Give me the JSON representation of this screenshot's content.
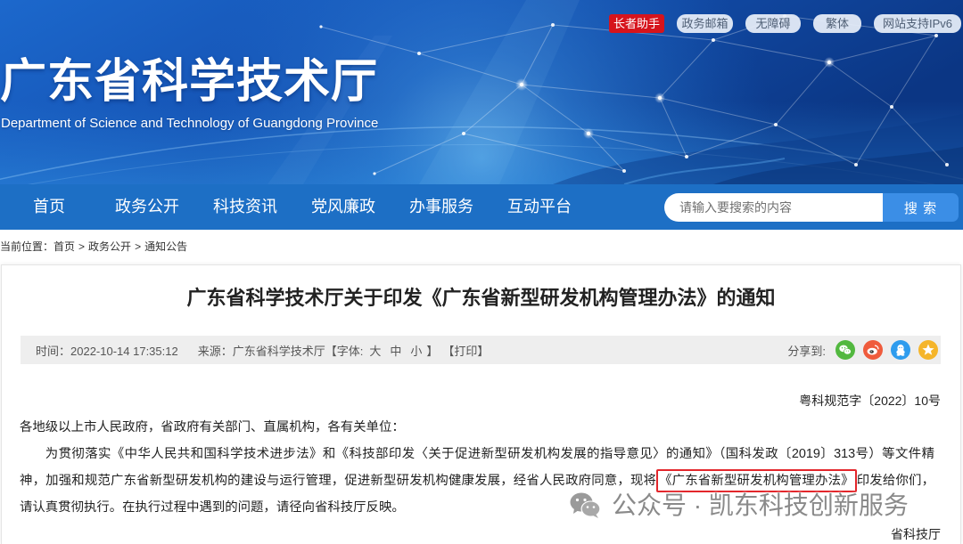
{
  "header": {
    "title": "广东省科学技术厅",
    "subtitle": "Department of Science and Technology of Guangdong Province",
    "top_links": [
      "长者助手",
      "政务邮箱",
      "无障碍",
      "繁体",
      "网站支持IPv6"
    ]
  },
  "nav": {
    "items": [
      "首页",
      "政务公开",
      "科技资讯",
      "党风廉政",
      "办事服务",
      "互动平台"
    ],
    "search": {
      "placeholder": "请输入要搜索的内容",
      "value": "",
      "button_label": "搜 索"
    }
  },
  "breadcrumb": {
    "prefix": "当前位置：",
    "items": [
      "首页",
      "政务公开",
      "通知公告"
    ],
    "separator": ">"
  },
  "article": {
    "title": "广东省科学技术厅关于印发《广东省新型研发机构管理办法》的通知",
    "meta": {
      "time": "时间：2022-10-14 17:35:12",
      "source": "来源：广东省科学技术厅",
      "font_label_open": "【字体:",
      "font_sizes": [
        "大",
        "中",
        "小"
      ],
      "font_label_close": "】",
      "print": "【打印】",
      "share_label": "分享到:",
      "share_icons": [
        "wechat-icon",
        "weibo-icon",
        "qq-icon",
        "qzone-star-icon"
      ]
    },
    "doc_number": "粤科规范字〔2022〕10号",
    "salutation": "各地级以上市人民政府，省政府有关部门、直属机构，各有关单位：",
    "body": {
      "before_highlight": "为贯彻落实《中华人民共和国科学技术进步法》和《科技部印发〈关于促进新型研发机构发展的指导意见〉的通知》（国科发政〔2019〕313号）等文件精神，加强和规范广东省新型研发机构的建设与运行管理，促进新型研发机构健康发展，经省人民政府同意，现将",
      "highlight": "《广东省新型研发机构管理办法》",
      "after_highlight": "印发给你们，请认真贯彻执行。在执行过程中遇到的问题，请径向省科技厅反映。"
    },
    "signature": "省科技厅"
  },
  "watermark": {
    "icon": "wechat-logo-icon",
    "text": "公众号 · 凯东科技创新服务"
  },
  "colors": {
    "nav_bg": "#1d6fc5",
    "search_button": "#3b8ee6",
    "elder_button": "#d6141c",
    "highlight_border": "#e3262b",
    "meta_bar_bg": "#eeeeee",
    "share_wechat": "#52b83f",
    "share_weibo": "#ef5b3c",
    "share_qq": "#2e9cee",
    "share_qzone": "#f5b52a"
  }
}
